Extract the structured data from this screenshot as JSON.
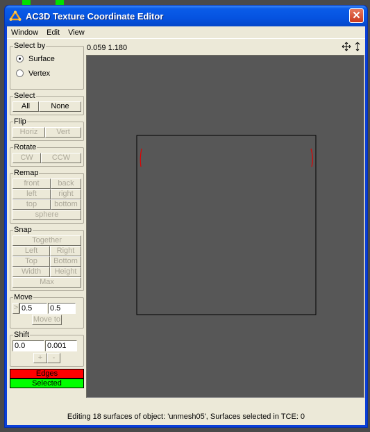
{
  "window": {
    "title": "AC3D Texture Coordinate Editor",
    "close_label": "✕"
  },
  "menubar": {
    "items": [
      "Window",
      "Edit",
      "View"
    ]
  },
  "coordinates": "0.059 1.180",
  "view_icons": [
    "pan-icon",
    "vertical-move-icon"
  ],
  "panel": {
    "select_by": {
      "label": "Select by",
      "options": [
        {
          "label": "Surface",
          "checked": true
        },
        {
          "label": "Vertex",
          "checked": false
        }
      ]
    },
    "select": {
      "label": "Select",
      "all": "All",
      "none": "None"
    },
    "flip": {
      "label": "Flip",
      "horiz": "Horiz",
      "vert": "Vert"
    },
    "rotate": {
      "label": "Rotate",
      "cw": "CW",
      "ccw": "CCW"
    },
    "remap": {
      "label": "Remap",
      "front": "front",
      "back": "back",
      "left": "left",
      "right": "right",
      "top": "top",
      "bottom": "bottom",
      "sphere": "sphere"
    },
    "snap": {
      "label": "Snap",
      "together": "Together",
      "left": "Left",
      "right": "Right",
      "top": "Top",
      "bottom": "Bottom",
      "width": "Width",
      "height": "Height",
      "max": "Max"
    },
    "move": {
      "label": "Move",
      "arrow": ">",
      "x": "0.5",
      "y": "0.5",
      "move_to": "Move to"
    },
    "shift": {
      "label": "Shift",
      "x": "0.0",
      "y": "0.001",
      "plus": "+",
      "minus": "-"
    },
    "legend": {
      "edges": "Edges",
      "selected": "Selected",
      "edges_color": "#ff0000",
      "selected_color": "#00ff00"
    }
  },
  "status": "Editing 18 surfaces of object: 'unmesh05', Surfaces selected in TCE: 0"
}
